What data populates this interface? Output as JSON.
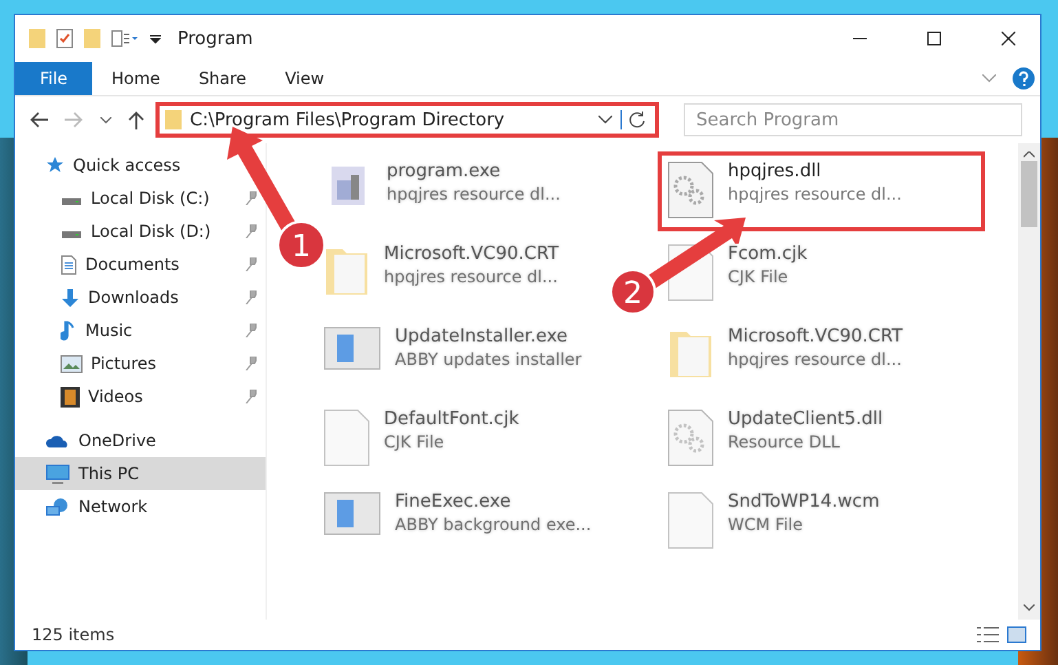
{
  "window": {
    "title": "Program"
  },
  "ribbon": {
    "tabs": [
      {
        "label": "File",
        "selected": true
      },
      {
        "label": "Home",
        "selected": false
      },
      {
        "label": "Share",
        "selected": false
      },
      {
        "label": "View",
        "selected": false
      }
    ]
  },
  "address_bar": {
    "path": "C:\\Program Files\\Program Directory",
    "highlighted": true
  },
  "search": {
    "placeholder": "Search Program"
  },
  "sidebar": {
    "items": [
      {
        "label": "Quick access",
        "kind": "star",
        "pinned": false,
        "selected": false,
        "children": [
          {
            "label": "Local Disk (C:)",
            "kind": "drive",
            "pinned": true,
            "selected": false
          },
          {
            "label": "Local Disk (D:)",
            "kind": "drive",
            "pinned": true,
            "selected": false
          },
          {
            "label": "Documents",
            "kind": "document",
            "pinned": true,
            "selected": false
          },
          {
            "label": "Downloads",
            "kind": "download",
            "pinned": true,
            "selected": false
          },
          {
            "label": "Music",
            "kind": "music",
            "pinned": true,
            "selected": false
          },
          {
            "label": "Pictures",
            "kind": "pictures",
            "pinned": true,
            "selected": false
          },
          {
            "label": "Videos",
            "kind": "videos",
            "pinned": true,
            "selected": false
          }
        ]
      },
      {
        "label": "OneDrive",
        "kind": "cloud",
        "pinned": false,
        "selected": false
      },
      {
        "label": "This PC",
        "kind": "pc",
        "pinned": false,
        "selected": true
      },
      {
        "label": "Network",
        "kind": "network",
        "pinned": false,
        "selected": false
      }
    ]
  },
  "files": [
    {
      "name": "program.exe",
      "description": "hpqjres resource dl...",
      "kind": "app",
      "highlighted": false,
      "blurred": true
    },
    {
      "name": "hpqjres.dll",
      "description": "hpqjres resource dl...",
      "kind": "dll",
      "highlighted": true,
      "blurred": false
    },
    {
      "name": "Microsoft.VC90.CRT",
      "description": "hpqjres resource dl...",
      "kind": "folder",
      "highlighted": false,
      "blurred": true
    },
    {
      "name": "Fcom.cjk",
      "description": "CJK File",
      "kind": "file",
      "highlighted": false,
      "blurred": true
    },
    {
      "name": "UpdateInstaller.exe",
      "description": "ABBY updates installer",
      "kind": "window",
      "highlighted": false,
      "blurred": true
    },
    {
      "name": "Microsoft.VC90.CRT",
      "description": "hpqjres resource dl...",
      "kind": "folder",
      "highlighted": false,
      "blurred": true
    },
    {
      "name": "DefaultFont.cjk",
      "description": "CJK File",
      "kind": "file",
      "highlighted": false,
      "blurred": true
    },
    {
      "name": "UpdateClient5.dll",
      "description": "Resource DLL",
      "kind": "dll",
      "highlighted": false,
      "blurred": true
    },
    {
      "name": "FineExec.exe",
      "description": "ABBY background exe...",
      "kind": "window",
      "highlighted": false,
      "blurred": true
    },
    {
      "name": "SndToWP14.wcm",
      "description": "WCM File",
      "kind": "file",
      "highlighted": false,
      "blurred": true
    }
  ],
  "callouts": [
    {
      "number": "1"
    },
    {
      "number": "2"
    }
  ],
  "status_bar": {
    "count": "125 items"
  }
}
